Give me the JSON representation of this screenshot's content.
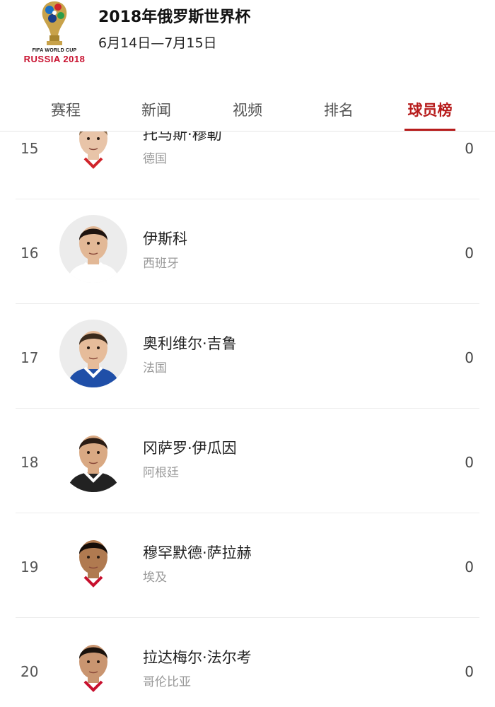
{
  "header": {
    "logo_line1": "FIFA WORLD CUP",
    "logo_line2": "RUSSIA 2018",
    "title": "2018年俄罗斯世界杯",
    "dates": "6月14日—7月15日"
  },
  "tabs": [
    {
      "label": "赛程"
    },
    {
      "label": "新闻"
    },
    {
      "label": "视频"
    },
    {
      "label": "排名"
    },
    {
      "label": "球员榜",
      "active": true
    }
  ],
  "players": [
    {
      "rank": "15",
      "name": "托马斯·穆勒",
      "team": "德国",
      "score": "0",
      "shirt": "#ffffff",
      "trim": "#d0242b",
      "skin": "#e8c4a8",
      "hair": "#8a6a4a"
    },
    {
      "rank": "16",
      "name": "伊斯科",
      "team": "西班牙",
      "score": "0",
      "shirt": "#ffffff",
      "trim": "#ffffff",
      "skin": "#e2b896",
      "hair": "#1e1410"
    },
    {
      "rank": "17",
      "name": "奥利维尔·吉鲁",
      "team": "法国",
      "score": "0",
      "shirt": "#1f4fa8",
      "trim": "#ffffff",
      "skin": "#e6bc9a",
      "hair": "#3a2a1c"
    },
    {
      "rank": "18",
      "name": "冈萨罗·伊瓜因",
      "team": "阿根廷",
      "score": "0",
      "shirt": "#222222",
      "trim": "#ffffff",
      "skin": "#d9a983",
      "hair": "#2a1c14"
    },
    {
      "rank": "19",
      "name": "穆罕默德·萨拉赫",
      "team": "埃及",
      "score": "0",
      "shirt": "#ffffff",
      "trim": "#c8102e",
      "skin": "#b07a50",
      "hair": "#140c08"
    },
    {
      "rank": "20",
      "name": "拉达梅尔·法尔考",
      "team": "哥伦比亚",
      "score": "0",
      "shirt": "#ffffff",
      "trim": "#c8102e",
      "skin": "#c99570",
      "hair": "#1a120c"
    }
  ]
}
